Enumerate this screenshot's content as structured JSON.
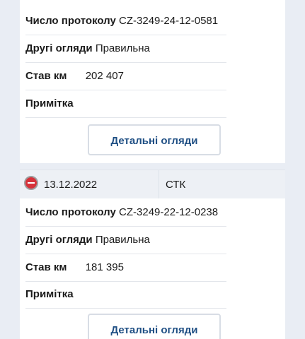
{
  "inspections": [
    {
      "protocol_label": "Число протоколу",
      "protocol_value": "CZ-3249-24-12-0581",
      "other_label": "Другі огляди",
      "other_value": "Правильна",
      "mileage_label": "Став км",
      "mileage_value": "202 407",
      "note_label": "Примітка",
      "details_button": "Детальні огляди"
    },
    {
      "status": "failed",
      "status_icon": "minus-circle-icon",
      "status_color": "#d6323a",
      "date": "13.12.2022",
      "type": "СТК",
      "protocol_label": "Число протоколу",
      "protocol_value": "CZ-3249-22-12-0238",
      "other_label": "Другі огляди",
      "other_value": "Правильна",
      "mileage_label": "Став км",
      "mileage_value": "181 395",
      "note_label": "Примітка",
      "details_button": "Детальні огляди"
    }
  ],
  "colors": {
    "page_background": "#e9edf4",
    "card_background": "#ffffff",
    "button_text": "#1f4f84",
    "header_background": "#edf0f5"
  }
}
